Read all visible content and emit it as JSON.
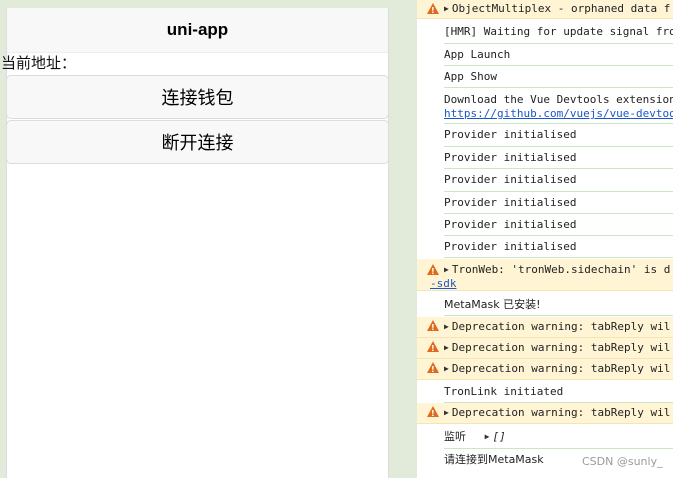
{
  "app": {
    "title": "uni-app",
    "address_label": "当前地址：",
    "connect_button": "连接钱包",
    "disconnect_button": "断开连接"
  },
  "console": {
    "rows": [
      {
        "type": "warn",
        "text": "ObjectMultiplex - orphaned data f"
      },
      {
        "type": "log",
        "text": "[HMR] Waiting for update signal fro"
      },
      {
        "type": "log",
        "text": "App Launch"
      },
      {
        "type": "log",
        "text": "App Show"
      },
      {
        "type": "log",
        "text": "Download the Vue Devtools extension",
        "link": "https://github.com/vuejs/vue-devtoo"
      },
      {
        "type": "log",
        "text": "Provider initialised"
      },
      {
        "type": "log",
        "text": "Provider initialised"
      },
      {
        "type": "log",
        "text": "Provider initialised"
      },
      {
        "type": "log",
        "text": "Provider initialised"
      },
      {
        "type": "log",
        "text": "Provider initialised"
      },
      {
        "type": "log",
        "text": "Provider initialised"
      },
      {
        "type": "warn",
        "text": "TronWeb: 'tronWeb.sidechain' is d",
        "link": "-sdk"
      },
      {
        "type": "log",
        "text": "MetaMask 已安装!"
      },
      {
        "type": "warn",
        "text": "Deprecation warning: tabReply wil"
      },
      {
        "type": "warn",
        "text": "Deprecation warning: tabReply wil"
      },
      {
        "type": "warn",
        "text": "Deprecation warning: tabReply wil"
      },
      {
        "type": "log",
        "text": "TronLink initiated"
      },
      {
        "type": "warn",
        "text": "Deprecation warning: tabReply wil"
      },
      {
        "type": "log",
        "text": "监听",
        "value": "[]"
      },
      {
        "type": "log",
        "text": "请连接到MetaMask"
      }
    ]
  },
  "watermark": "CSDN @sunly_",
  "colors": {
    "warn_bg": "#fff5d5",
    "warn_icon": "#e06a1b",
    "link": "#1a56c8"
  }
}
